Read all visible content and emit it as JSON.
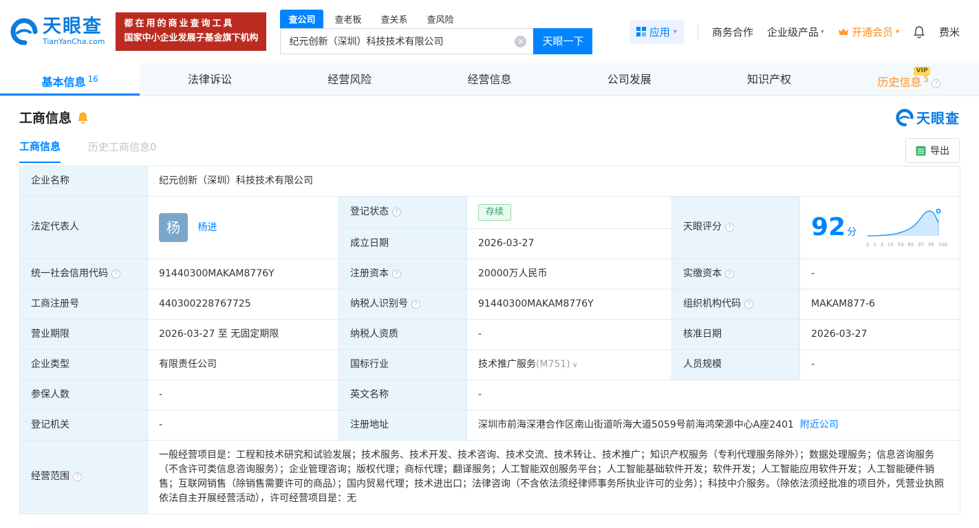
{
  "header": {
    "logo_title": "天眼查",
    "logo_subtitle": "TianYanCha.com",
    "banner_line1": "都在用的商业查询工具",
    "banner_line2": "国家中小企业发展子基金旗下机构",
    "search_tabs": [
      {
        "label": "查公司"
      },
      {
        "label": "查老板"
      },
      {
        "label": "查关系"
      },
      {
        "label": "查风险"
      }
    ],
    "search_value": "纪元创新（深圳）科技技术有限公司",
    "search_button": "天眼一下",
    "app_label": "应用",
    "biz_label": "商务合作",
    "enterprise_label": "企业级产品",
    "vip_label": "开通会员",
    "user_label": "费米"
  },
  "nav": {
    "tabs": [
      {
        "label": "基本信息",
        "badge": "16"
      },
      {
        "label": "法律诉讼",
        "badge": ""
      },
      {
        "label": "经营风险",
        "badge": ""
      },
      {
        "label": "经营信息",
        "badge": ""
      },
      {
        "label": "公司发展",
        "badge": ""
      },
      {
        "label": "知识产权",
        "badge": ""
      },
      {
        "label": "历史信息",
        "badge": "5",
        "vip": "VIP"
      }
    ]
  },
  "section": {
    "title": "工商信息",
    "brand": "天眼查",
    "tab_current": "工商信息",
    "tab_history": "历史工商信息0",
    "export_label": "导出"
  },
  "info": {
    "company_name_label": "企业名称",
    "company_name": "纪元创新（深圳）科技技术有限公司",
    "legal_rep_label": "法定代表人",
    "legal_rep_avatar": "杨",
    "legal_rep_name": "杨进",
    "reg_status_label": "登记状态",
    "reg_status": "存续",
    "score_label": "天眼评分",
    "est_date_label": "成立日期",
    "est_date": "2026-03-27",
    "credit_code_label": "统一社会信用代码",
    "credit_code": "91440300MAKAM8776Y",
    "reg_capital_label": "注册资本",
    "reg_capital": "20000万人民币",
    "paid_capital_label": "实缴资本",
    "paid_capital": "-",
    "reg_number_label": "工商注册号",
    "reg_number": "440300228767725",
    "taxpayer_id_label": "纳税人识别号",
    "taxpayer_id": "91440300MAKAM8776Y",
    "org_code_label": "组织机构代码",
    "org_code": "MAKAM877-6",
    "business_term_label": "营业期限",
    "business_term": "2026-03-27 至 无固定期限",
    "taxpayer_qual_label": "纳税人资质",
    "taxpayer_qual": "-",
    "approval_date_label": "核准日期",
    "approval_date": "2026-03-27",
    "company_type_label": "企业类型",
    "company_type": "有限责任公司",
    "industry_label": "国标行业",
    "industry": "技术推广服务",
    "industry_code": "(M751)",
    "staff_size_label": "人员规模",
    "staff_size": "-",
    "insured_label": "参保人数",
    "insured": "-",
    "english_name_label": "英文名称",
    "english_name": "-",
    "reg_authority_label": "登记机关",
    "reg_authority": "-",
    "reg_address_label": "注册地址",
    "reg_address": "深圳市前海深港合作区南山街道听海大道5059号前海鸿荣源中心A座2401",
    "nearby_link": "附近公司",
    "business_scope_label": "经营范围",
    "business_scope": "一般经营项目是：工程和技术研究和试验发展；技术服务、技术开发、技术咨询、技术交流、技术转让、技术推广；知识产权服务（专利代理服务除外）；数据处理服务；信息咨询服务（不含许可类信息咨询服务）；企业管理咨询；版权代理；商标代理；翻译服务；人工智能双创服务平台；人工智能基础软件开发；软件开发；人工智能应用软件开发；人工智能硬件销售；互联网销售（除销售需要许可的商品）；国内贸易代理；技术进出口；法律咨询（不含依法须经律师事务所执业许可的业务）；科技中介服务。（除依法须经批准的项目外，凭营业执照依法自主开展经营活动），许可经营项目是：无"
  },
  "score_chart": {
    "score": "92",
    "unit": "分",
    "axis_labels": [
      "0",
      "1",
      "3",
      "15",
      "50",
      "85",
      "97",
      "99",
      "100"
    ]
  }
}
